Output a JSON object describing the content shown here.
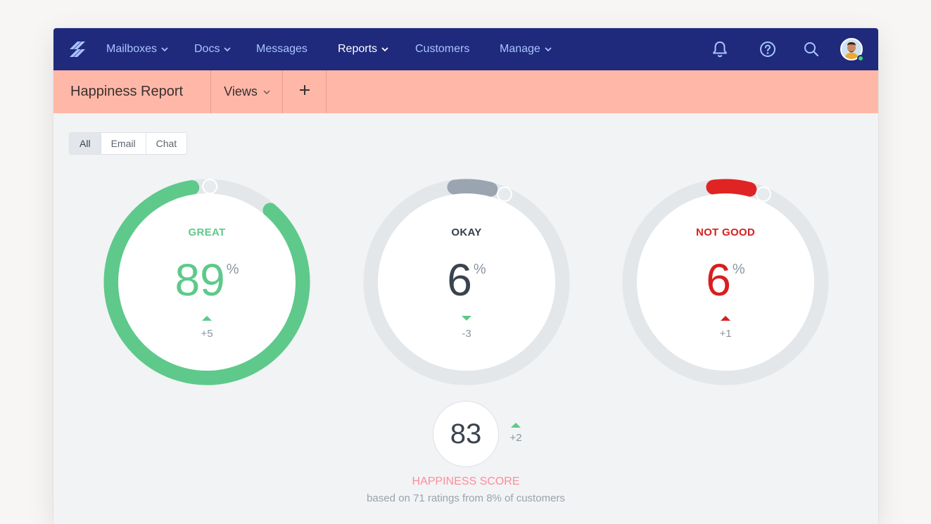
{
  "nav": {
    "items": [
      {
        "label": "Mailboxes",
        "has_chevron": true
      },
      {
        "label": "Docs",
        "has_chevron": true
      },
      {
        "label": "Messages",
        "has_chevron": false
      },
      {
        "label": "Reports",
        "has_chevron": true,
        "active": true
      },
      {
        "label": "Customers",
        "has_chevron": false
      },
      {
        "label": "Manage",
        "has_chevron": true
      }
    ],
    "icons": [
      "bell-icon",
      "help-icon",
      "search-icon",
      "avatar"
    ]
  },
  "subheader": {
    "title": "Happiness Report",
    "views_label": "Views",
    "add_label": "+"
  },
  "filter": {
    "options": [
      "All",
      "Email",
      "Chat"
    ],
    "selected": "All"
  },
  "gauges": [
    {
      "label": "GREAT",
      "value": "89",
      "unit": "%",
      "delta": "+5",
      "direction": "up",
      "fraction": 0.89,
      "color": "#5ec98a"
    },
    {
      "label": "OKAY",
      "value": "6",
      "unit": "%",
      "delta": "-3",
      "direction": "down",
      "fraction": 0.06,
      "color": "#9aa5b1"
    },
    {
      "label": "NOT GOOD",
      "value": "6",
      "unit": "%",
      "delta": "+1",
      "direction": "up",
      "fraction": 0.06,
      "color": "#e02424"
    }
  ],
  "score": {
    "value": "83",
    "delta": "+2",
    "title": "HAPPINESS SCORE",
    "subtitle": "based on 71 ratings from 8% of customers"
  },
  "colors": {
    "nav_bg": "#1f2a7c",
    "nav_text": "#a9c4ff",
    "subheader_bg": "#ffb8a8",
    "great": "#5ec98a",
    "okay_text": "#36404a",
    "not_good": "#d91e1e",
    "score_title": "#ff8c9a"
  }
}
